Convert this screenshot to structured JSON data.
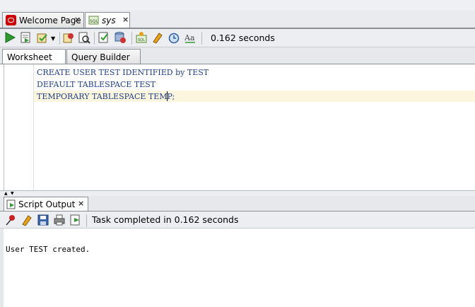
{
  "doc_tabs": [
    {
      "label": "Welcome Page",
      "close": "×"
    },
    {
      "label": "sys",
      "close": "×"
    }
  ],
  "toolbar": {
    "buttons": [
      "run-statement-icon",
      "run-script-icon",
      "commit-icon",
      "rollback-icon",
      "explain-plan-icon",
      "autotrace-icon",
      "sql-tuning-icon",
      "clear-icon",
      "history-icon",
      "format-icon"
    ],
    "elapsed": "0.162 seconds"
  },
  "sub_tabs": [
    {
      "label": "Worksheet",
      "active": true
    },
    {
      "label": "Query Builder",
      "active": false
    }
  ],
  "editor": {
    "lines": [
      "CREATE USER TEST IDENTIFIED by TEST",
      "DEFAULT TABLESPACE TEST",
      "TEMPORARY TABLESPACE TEMP;"
    ]
  },
  "output_panel": {
    "tab_label": "Script Output",
    "tab_close": "×",
    "status": "Task completed in 0.162 seconds",
    "text": "User TEST created."
  },
  "colors": {
    "keyword": "#1f3f8a",
    "current_line": "#fbf6dd",
    "oracle_red": "#cc0000"
  }
}
